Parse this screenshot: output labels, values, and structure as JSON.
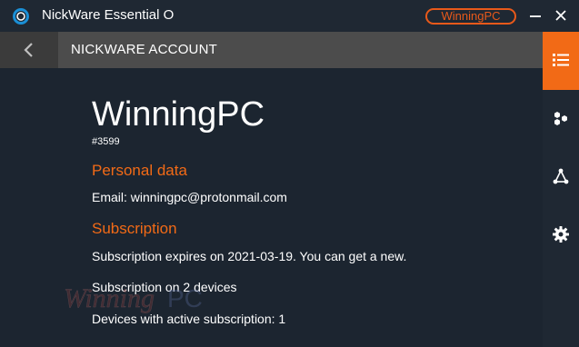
{
  "window": {
    "title": "NickWare Essential O",
    "account_badge": "WinningPC"
  },
  "header": {
    "title": "NICKWARE ACCOUNT"
  },
  "account": {
    "name": "WinningPC",
    "id": "#3599",
    "personal_heading": "Personal data",
    "email_line": "Email: winningpc@protonmail.com",
    "subscription_heading": "Subscription",
    "expires_line": "Subscription expires on 2021-03-19. You can get a new.",
    "devices_line": "Subscription on 2 devices",
    "active_line": "Devices with active subscription: 1"
  },
  "watermark": {
    "text": "WinningPC"
  },
  "sidebar": {
    "items": [
      {
        "icon": "list-icon",
        "active": true
      },
      {
        "icon": "hexagons-icon",
        "active": false
      },
      {
        "icon": "network-icon",
        "active": false
      },
      {
        "icon": "gear-icon",
        "active": false
      }
    ]
  },
  "colors": {
    "accent": "#f26a16",
    "background": "#1c2530",
    "header": "#4c4c4c"
  }
}
